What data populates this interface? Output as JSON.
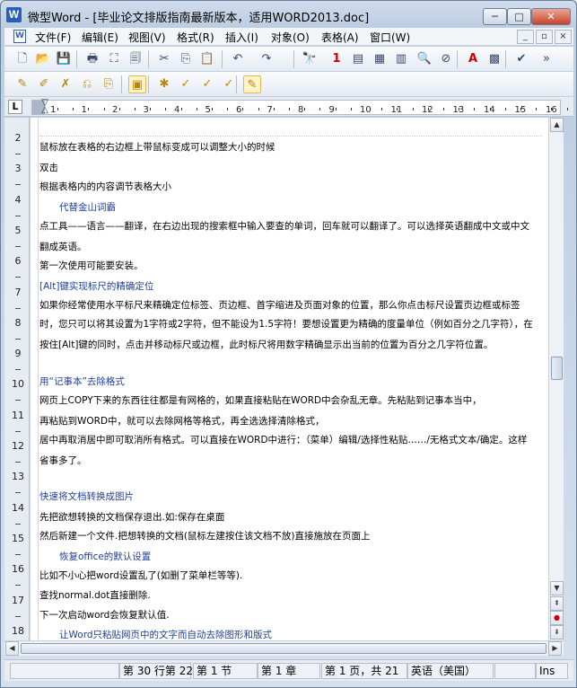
{
  "window": {
    "app_icon": "W",
    "title": "微型Word - [毕业论文排版指南最新版本，适用WORD2013.doc]",
    "controls": {
      "minimize": "─",
      "maximize": "□",
      "close": "✕"
    }
  },
  "menubar": {
    "items": [
      "文件(F)",
      "编辑(E)",
      "视图(V)",
      "格式(R)",
      "插入(I)",
      "对象(O)",
      "表格(A)",
      "窗口(W)"
    ],
    "mdi": {
      "minimize": "_",
      "restore": "▫",
      "close": "×"
    }
  },
  "toolbar1": {
    "icons": [
      "new-document-icon",
      "open-folder-icon",
      "save-icon",
      "print-icon",
      "pdf-icon",
      "print-preview-icon",
      "cut-icon",
      "copy-icon",
      "paste-icon",
      "undo-icon",
      "redo-icon",
      "find-icon",
      "page-number-icon",
      "insert-page-icon",
      "layout-icon",
      "columns-icon",
      "zoom-icon",
      "no-format-icon",
      "font-color-icon",
      "image-icon",
      "spell-check-icon",
      "more-icon"
    ],
    "glyphs": [
      "🗋",
      "📂",
      "💾",
      "🖶",
      "⛶",
      "🗐",
      "✂",
      "⎘",
      "📋",
      "↶",
      "↷",
      "🔭",
      "1",
      "▤",
      "▦",
      "▥",
      "🔍",
      "⊘",
      "A",
      "▩",
      "✔",
      "»"
    ]
  },
  "toolbar2": {
    "icons": [
      "comment-icon",
      "edit-comment-icon",
      "delete-comment-icon",
      "previous-comment-icon",
      "next-comment-icon",
      "track-changes-icon",
      "accept-icon",
      "accept-all-icon",
      "reject-icon",
      "reject-all-icon",
      "reviewing-pane-icon"
    ],
    "glyphs": [
      "✎",
      "✐",
      "✗",
      "⎌",
      "⎘",
      "▣",
      "✱",
      "✓",
      "✓",
      "✓",
      "✎"
    ]
  },
  "ruler": {
    "corner": "L",
    "labels": [
      "1",
      "1",
      "2",
      "3",
      "4",
      "5",
      "6",
      "7",
      "8",
      "9",
      "10",
      "11",
      "12",
      "13",
      "14",
      "15",
      "16"
    ]
  },
  "vruler": {
    "labels": [
      "2",
      "3",
      "4",
      "5",
      "6",
      "7",
      "8",
      "9",
      "10",
      "11",
      "12",
      "13",
      "14",
      "15",
      "16",
      "17",
      "18"
    ]
  },
  "document": {
    "lines": [
      "鼠标放在表格的右边框上带鼠标变成可以调整大小的时候",
      "双击",
      "根据表格内的内容调节表格大小",
      "代替金山词霸",
      "点工具——语言——翻译，在右边出现的搜索框中输入要查的单词，回车就可以翻译了。可以选择英语翻成中文或中文",
      "翻成英语。",
      "第一次使用可能要安装。",
      "[Alt]键实现标尺的精确定位",
      "如果你经常使用水平标尺来精确定位标签、页边框、首字缩进及页面对象的位置，那么你点击标尺设置页边框或标签",
      "时，您只可以将其设置为1字符或2字符，但不能设为1.5字符！要想设置更为精确的度量单位（例如百分之几字符），在",
      "按住[Alt]键的同时，点击并移动标尺或边框，此时标尺将用数字精确显示出当前的位置为百分之几字符位置。",
      "用“记事本”去除格式",
      "网页上COPY下来的东西往往都是有网格的，如果直接粘贴在WORD中会杂乱无章。先粘贴到记事本当中，",
      "再粘贴到WORD中，就可以去除网格等格式，再全选选择清除格式，",
      "居中再取消居中即可取消所有格式。可以直接在WORD中进行：（菜单）编辑/选择性粘贴……/无格式文本/确定。这样",
      "省事多了。",
      "快速将文档转换成图片",
      "先把欲想转换的文档保存退出.如:保存在桌面",
      "然后新建一个文件.把想转换的文档(鼠标左建按住该文档不放)直接施放在页面上",
      "恢复office的默认设置",
      "比如不小心把word设置乱了(如删了菜单栏等等).",
      "查找normal.dot直接删除.",
      "下一次启动word会恢复默认值.",
      "让Word只粘贴网页中的文字而自动去除图形和版式"
    ]
  },
  "scroll": {
    "up": "▲",
    "down": "▼",
    "left": "◀",
    "right": "▶",
    "prev_page": "⇞",
    "browse": "●",
    "next_page": "⇟"
  },
  "statusbar": {
    "position": "第 30 行第 22",
    "section": "第 1 节",
    "chapter": "第 1 章",
    "page": "第 1 页，共 21",
    "language": "英语（美国）",
    "mode": "Ins"
  }
}
